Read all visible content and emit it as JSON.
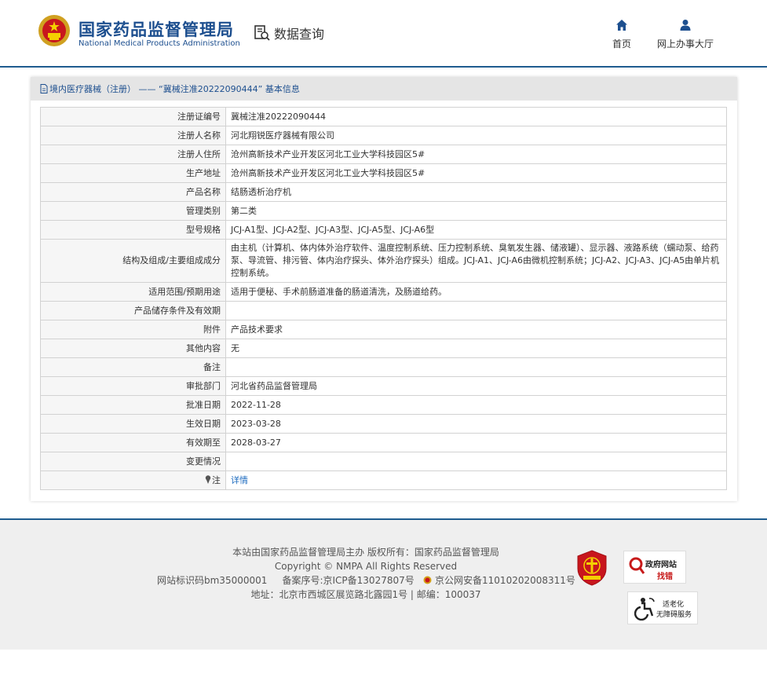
{
  "header": {
    "org_name_cn": "国家药品监督管理局",
    "org_name_en": "National Medical Products Administration",
    "query_label": "数据查询",
    "nav_home": "首页",
    "nav_hall": "网上办事大厅"
  },
  "panel": {
    "title": "境内医疗器械（注册） —— “冀械注准20222090444” 基本信息"
  },
  "rows": [
    {
      "label": "注册证编号",
      "value": "冀械注准20222090444"
    },
    {
      "label": "注册人名称",
      "value": "河北翔锐医疗器械有限公司"
    },
    {
      "label": "注册人住所",
      "value": "沧州高新技术产业开发区河北工业大学科技园区5#"
    },
    {
      "label": "生产地址",
      "value": "沧州高新技术产业开发区河北工业大学科技园区5#"
    },
    {
      "label": "产品名称",
      "value": "结肠透析治疗机"
    },
    {
      "label": "管理类别",
      "value": "第二类"
    },
    {
      "label": "型号规格",
      "value": "JCJ-A1型、JCJ-A2型、JCJ-A3型、JCJ-A5型、JCJ-A6型"
    },
    {
      "label": "结构及组成/主要组成成分",
      "value": "由主机（计算机、体内体外治疗软件、温度控制系统、压力控制系统、臭氧发生器、储液罐）、显示器、液路系统（蠕动泵、给药泵、导流管、排污管、体内治疗探头、体外治疗探头）组成。JCJ-A1、JCJ-A6由微机控制系统；JCJ-A2、JCJ-A3、JCJ-A5由单片机控制系统。"
    },
    {
      "label": "适用范围/预期用途",
      "value": "适用于便秘、手术前肠道准备的肠道清洗，及肠道给药。"
    },
    {
      "label": "产品储存条件及有效期",
      "value": ""
    },
    {
      "label": "附件",
      "value": "产品技术要求"
    },
    {
      "label": "其他内容",
      "value": "无"
    },
    {
      "label": "备注",
      "value": ""
    },
    {
      "label": "审批部门",
      "value": "河北省药品监督管理局"
    },
    {
      "label": "批准日期",
      "value": "2022-11-28"
    },
    {
      "label": "生效日期",
      "value": "2023-03-28"
    },
    {
      "label": "有效期至",
      "value": "2028-03-27"
    },
    {
      "label": "变更情况",
      "value": ""
    }
  ],
  "note_row": {
    "label": "注",
    "link": "详情"
  },
  "footer": {
    "line1": "本站由国家药品监督管理局主办 版权所有：国家药品监督管理局",
    "line2": "Copyright © NMPA All Rights Reserved",
    "line3_a": "网站标识码bm35000001",
    "line3_b": "备案序号:京ICP备13027807号",
    "line3_c": "京公网安备11010202008311号",
    "line4": "地址：北京市西城区展览路北露园1号 | 邮编：100037",
    "badge_zhaocuo_title": "政府网站",
    "badge_zhaocuo_sub": "找错",
    "badge_access_1": "适老化",
    "badge_access_2": "无障碍服务"
  },
  "colors": {
    "brand_blue": "#1d4f8f",
    "link_blue": "#1d6bbf",
    "header_line": "#1f5c8f",
    "footer_bg": "#efefef"
  },
  "icons": {
    "emblem": "national-emblem-icon",
    "query": "search-document-icon",
    "home": "home-icon",
    "user": "user-icon",
    "doc": "document-icon",
    "pin": "pin-icon"
  }
}
